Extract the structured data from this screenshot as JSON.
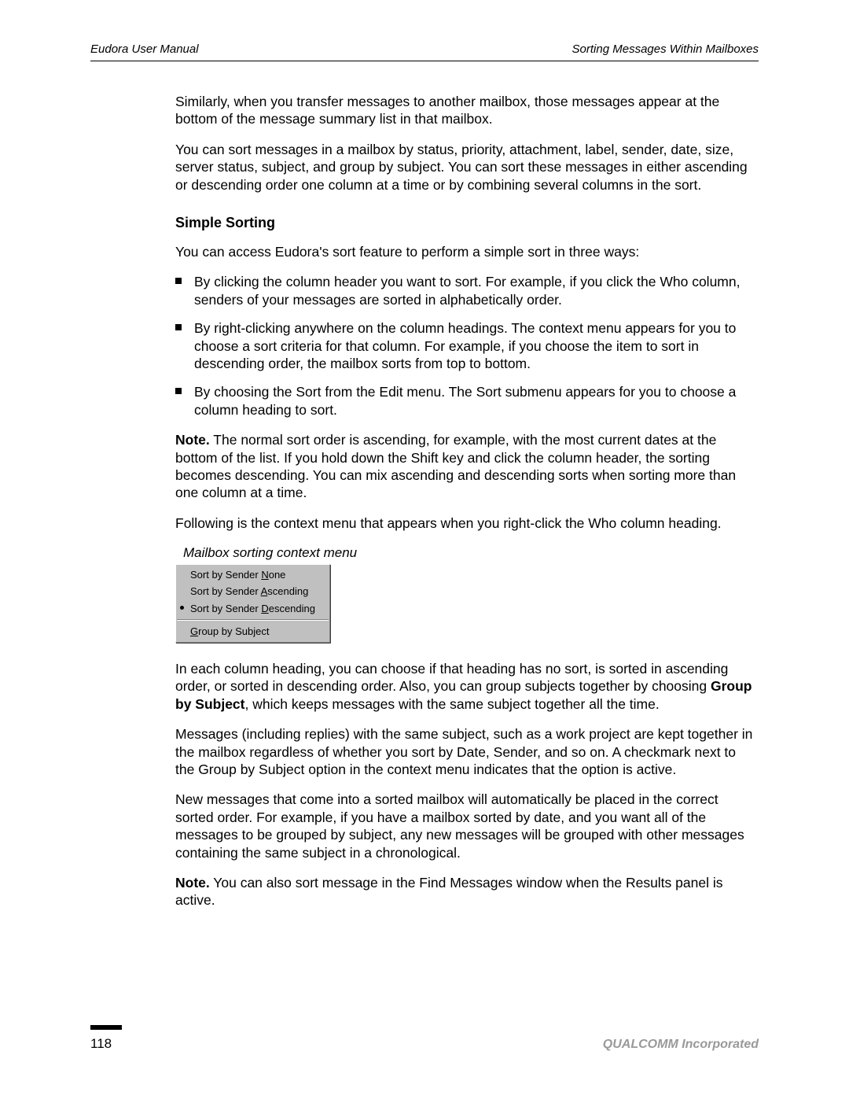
{
  "header": {
    "left": "Eudora User Manual",
    "right": "Sorting Messages Within Mailboxes"
  },
  "body": {
    "p1": "Similarly, when you transfer messages to another mailbox, those messages appear at the bottom of the message summary list in that mailbox.",
    "p2": "You can sort messages in a mailbox by status, priority, attachment, label, sender, date, size, server status, subject, and group by subject. You can sort these messages in either ascending or descending order one column at a time or by combining several columns in the sort.",
    "h1": "Simple Sorting",
    "p3": "You can access Eudora's sort feature to perform a simple sort in three ways:",
    "bullets": [
      "By clicking the column header you want to sort. For example, if you click the Who column, senders of your messages are sorted in alphabetically order.",
      "By right-clicking anywhere on the column headings. The context menu appears for you to choose a sort criteria for that column. For example, if you choose the item to sort in descending order, the mailbox sorts from top to bottom.",
      "By choosing the Sort from the Edit menu. The Sort submenu appears for you to choose a column heading to sort."
    ],
    "note1_label": "Note.",
    "note1_text": " The normal sort order is ascending, for example, with the most current dates at the bottom of the list. If you hold down the Shift key and click the column header, the sorting becomes descending. You can mix ascending and descending sorts when sorting more than one column at a time.",
    "p4": "Following is the context menu that appears when you right-click the Who column heading.",
    "caption": "Mailbox sorting context menu",
    "p5a": "In each column heading, you can choose if that heading has no sort, is sorted in ascending order, or sorted in descending order. Also, you can group subjects together by choosing ",
    "p5b": "Group by Subject",
    "p5c": ", which keeps messages with the same subject together all the time.",
    "p6": "Messages (including replies) with the same subject, such as a work project are kept together in the mailbox regardless of whether you sort by Date, Sender, and so on. A checkmark next to the Group by Subject option in the context menu indicates that the option is active.",
    "p7": "New messages that come into a sorted mailbox will automatically be placed in the correct sorted order. For example, if you have a mailbox sorted by date, and you want all of the messages to be grouped by subject, any new messages will be grouped with other messages containing the same subject in a chronological.",
    "note2_label": "Note.",
    "note2_text": " You can also sort message in the Find Messages window when the Results panel is active."
  },
  "menu": {
    "item1_pre": "Sort by Sender ",
    "item1_u": "N",
    "item1_post": "one",
    "item2_pre": "Sort by Sender ",
    "item2_u": "A",
    "item2_post": "scending",
    "item3_pre": "Sort by Sender ",
    "item3_u": "D",
    "item3_post": "escending",
    "item4_u": "G",
    "item4_post": "roup by Subject"
  },
  "footer": {
    "page": "118",
    "company": "QUALCOMM Incorporated"
  }
}
